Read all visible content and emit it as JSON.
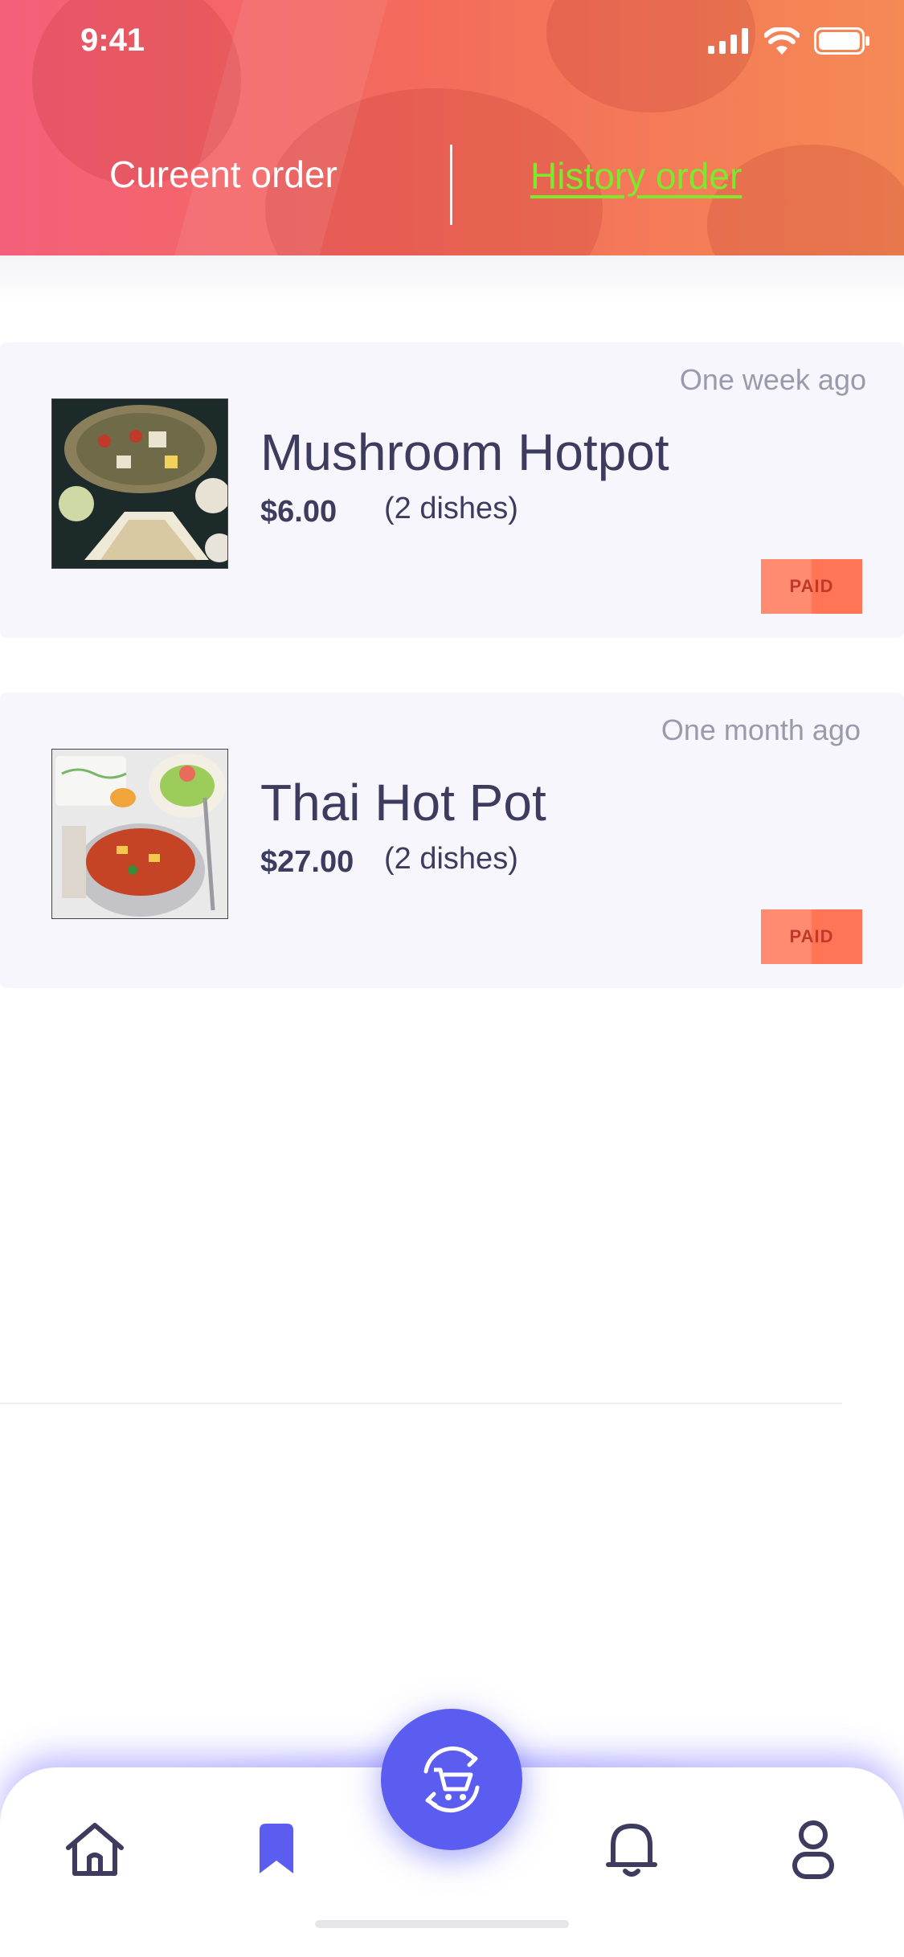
{
  "status_bar": {
    "time": "9:41"
  },
  "tabs": {
    "current_label": "Cureent order",
    "history_label": "History order"
  },
  "orders": [
    {
      "time": "One week ago",
      "name": "Mushroom Hotpot",
      "price": "$6.00",
      "dishes": "(2 dishes)",
      "status": "PAID"
    },
    {
      "time": "One month ago",
      "name": "Thai Hot Pot",
      "price": "$27.00",
      "dishes": "(2 dishes)",
      "status": "PAID"
    }
  ],
  "bottom_nav": {
    "items": [
      "home-icon",
      "bookmark-icon",
      "cart-refresh-icon",
      "bell-icon",
      "user-icon"
    ],
    "active": "bookmark-icon"
  },
  "colors": {
    "accent": "#5a5df0",
    "active_tab": "#7ee82e",
    "text_dark": "#3d3b5e",
    "paid_badge": "#ff7f62"
  }
}
